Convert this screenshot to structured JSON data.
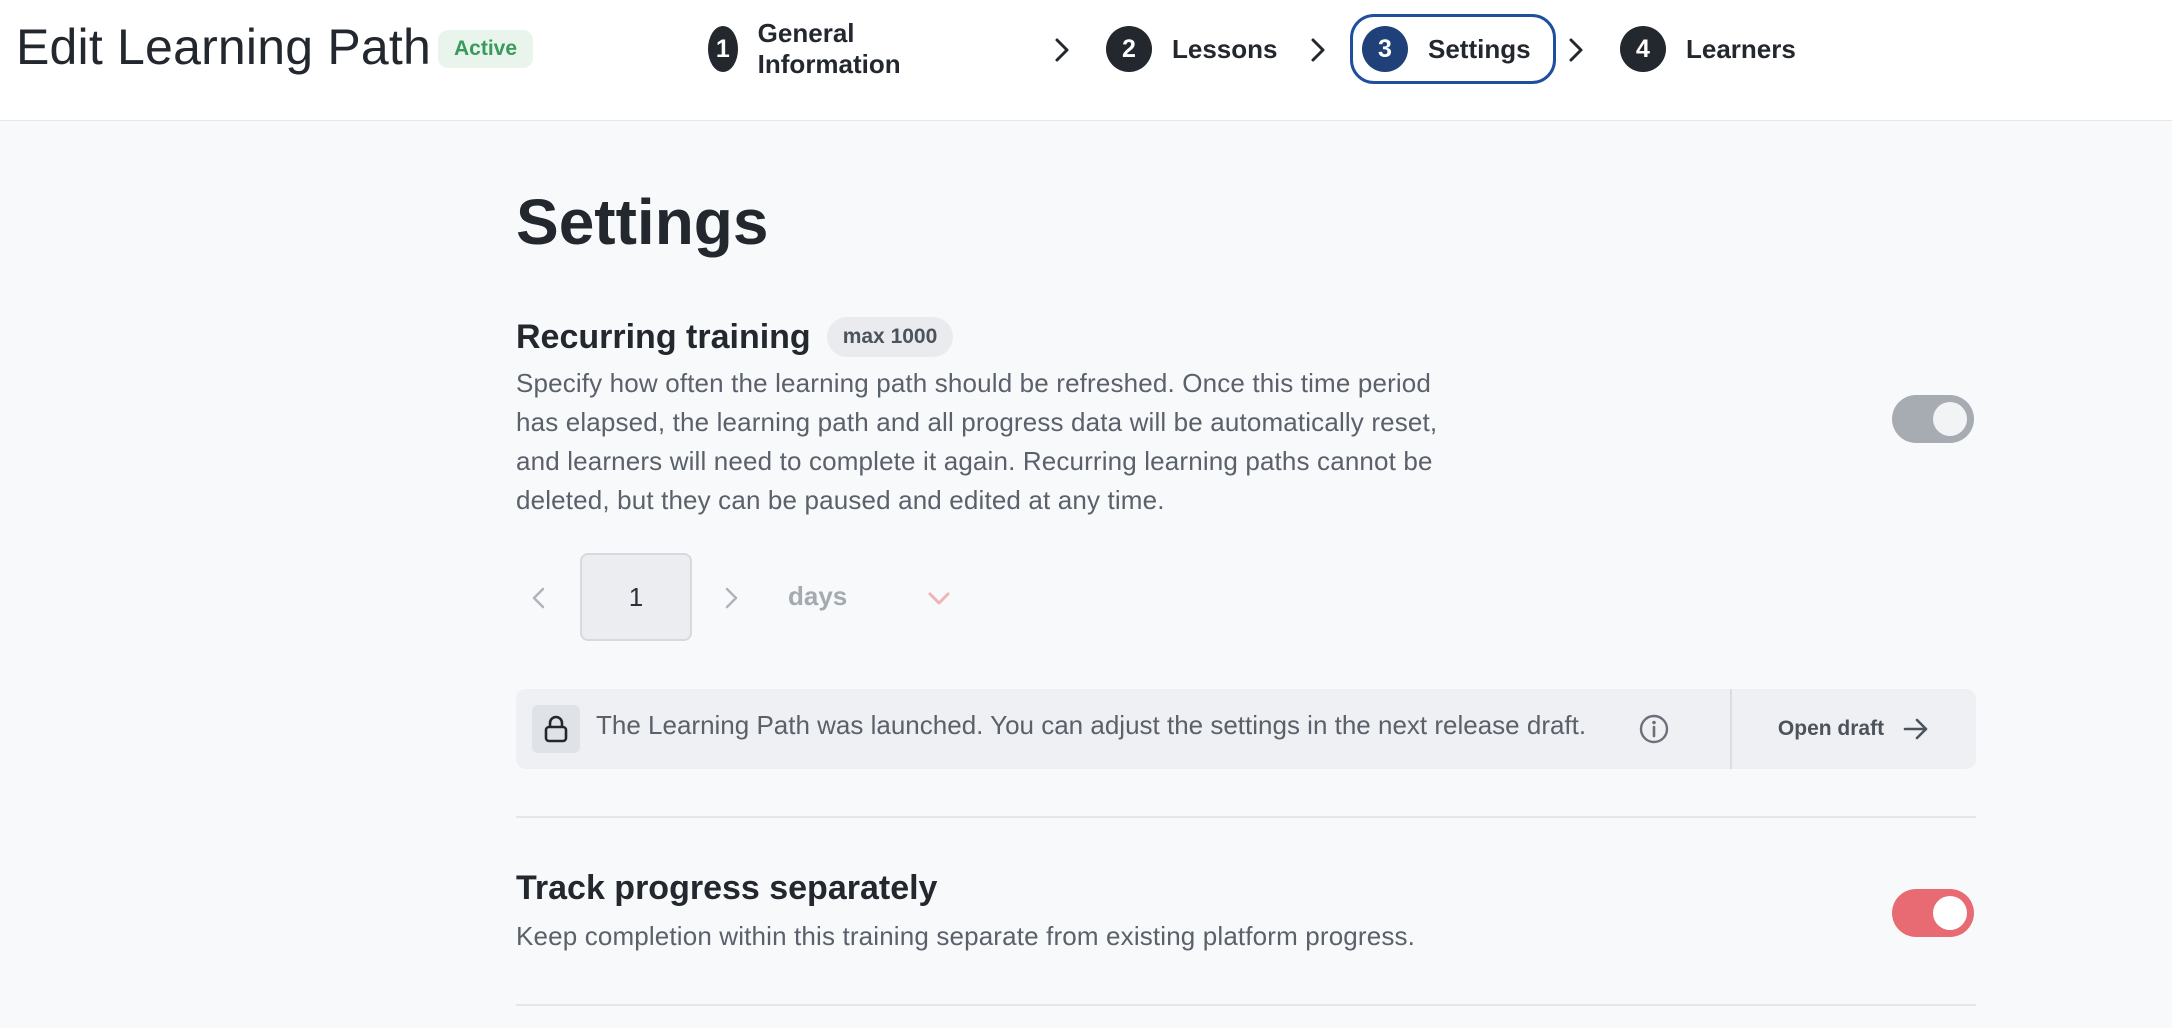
{
  "header": {
    "title": "Edit Learning Path",
    "status": "Active",
    "steps": [
      {
        "number": "1",
        "label": "General Information"
      },
      {
        "number": "2",
        "label": "Lessons"
      },
      {
        "number": "3",
        "label": "Settings"
      },
      {
        "number": "4",
        "label": "Learners"
      }
    ],
    "active_step": 3
  },
  "settings": {
    "title": "Settings",
    "recurring": {
      "title": "Recurring training",
      "badge": "max 1000",
      "description_lines": [
        "Specify how often the learning path should be refreshed. Once this time period",
        "has elapsed, the learning path and all progress data will be automatically reset,",
        "and learners will need to complete it again. Recurring learning paths cannot be",
        "deleted, but they can be paused and edited at any time."
      ],
      "enabled": false,
      "interval_value": "1",
      "interval_unit": "days"
    },
    "notice": {
      "text": "The Learning Path was launched. You can adjust the settings in the next release draft.",
      "action_label": "Open draft"
    },
    "track_progress": {
      "title": "Track progress separately",
      "description": "Keep completion within this training separate from existing platform progress.",
      "enabled": true
    }
  },
  "colors": {
    "accent_blue": "#1f4f9c",
    "toggle_on": "#e86a73",
    "toggle_off": "#a7abb2",
    "status_green": "#3a9a5b"
  }
}
